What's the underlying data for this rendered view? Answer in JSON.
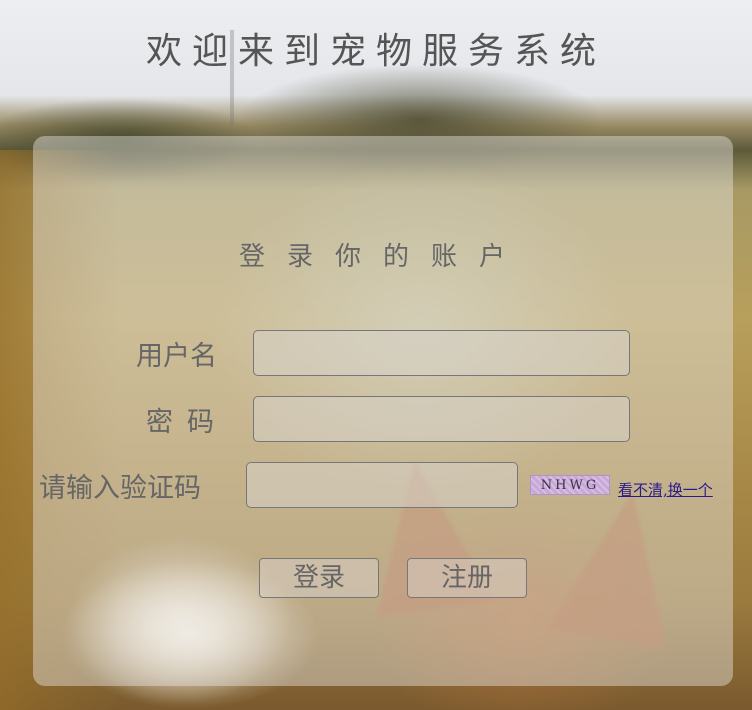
{
  "header": {
    "title": "欢迎来到宠物服务系统"
  },
  "login_panel": {
    "title": "登录你的账户",
    "username": {
      "label": "用户名",
      "value": "",
      "placeholder": ""
    },
    "password": {
      "label": "密码",
      "value": "",
      "placeholder": ""
    },
    "captcha": {
      "label": "请输入验证码",
      "value": "",
      "placeholder": "",
      "image_text": "NHWG",
      "refresh_link": "看不清,换一个"
    },
    "buttons": {
      "login": "登录",
      "register": "注册"
    }
  },
  "colors": {
    "text": "#666666",
    "link": "#2a1a8a",
    "captcha_bg": "#c9a8d8"
  }
}
